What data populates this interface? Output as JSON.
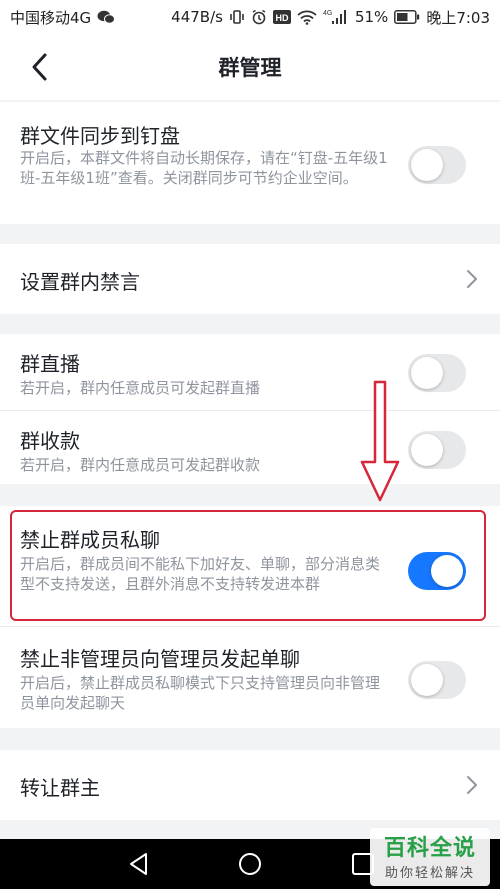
{
  "status_bar": {
    "carrier": "中国移动4G",
    "speed": "447B/s",
    "network": "4G",
    "battery": "51%",
    "time": "晚上7:03"
  },
  "nav": {
    "title": "群管理"
  },
  "rows": {
    "dingpan": {
      "title": "群文件同步到钉盘",
      "desc": "开启后，本群文件将自动长期保存，请在“钉盘-五年级1班-五年级1班”查看。关闭群同步可节约企业空间。",
      "enabled": false
    },
    "mute": {
      "title": "设置群内禁言"
    },
    "live": {
      "title": "群直播",
      "desc": "若开启，群内任意成员可发起群直播",
      "enabled": false
    },
    "payment": {
      "title": "群收款",
      "desc": "若开启，群内任意成员可发起群收款",
      "enabled": false
    },
    "private_chat": {
      "title": "禁止群成员私聊",
      "desc": "开启后，群成员间不能私下加好友、单聊，部分消息类型不支持发送，且群外消息不支持转发进本群",
      "enabled": true
    },
    "non_admin_chat": {
      "title": "禁止非管理员向管理员发起单聊",
      "desc": "开启后，禁止群成员私聊模式下只支持管理员向非管理员单向发起聊天",
      "enabled": false
    },
    "transfer": {
      "title": "转让群主"
    }
  },
  "watermark": {
    "main": "百科全说",
    "sub": "助你轻松解决"
  },
  "colors": {
    "accent": "#1677ff",
    "annotation": "#d6263a",
    "watermark": "#27a047"
  }
}
